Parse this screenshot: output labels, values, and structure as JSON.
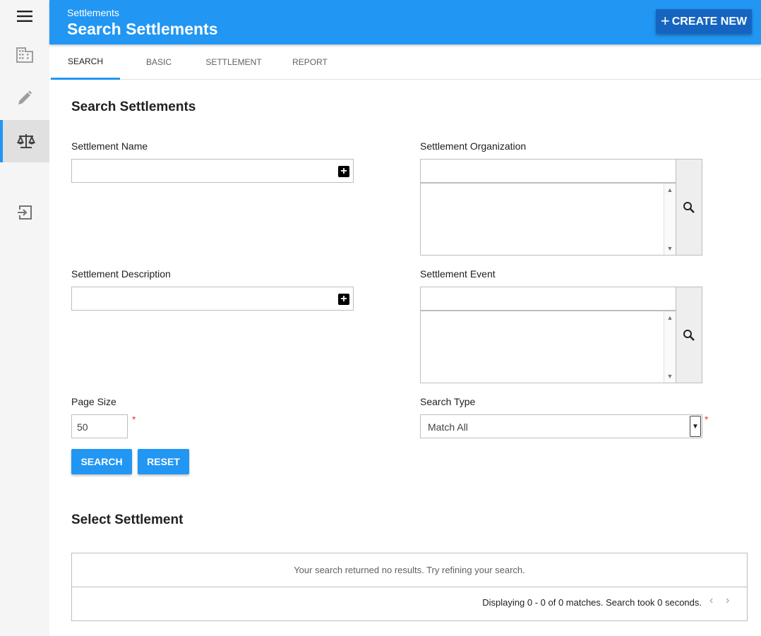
{
  "rail": {
    "items": [
      {
        "icon": "menu-icon"
      },
      {
        "icon": "building-icon"
      },
      {
        "icon": "pencil-icon"
      },
      {
        "icon": "scales-icon",
        "active": true
      },
      {
        "icon": "sign-in-icon"
      }
    ]
  },
  "header": {
    "breadcrumb": "Settlements",
    "title": "Search Settlements",
    "create_label": "CREATE NEW",
    "create_icon": "plus-icon",
    "color": "#2196f3"
  },
  "tabs": [
    {
      "label": "SEARCH",
      "active": true
    },
    {
      "label": "BASIC"
    },
    {
      "label": "SETTLEMENT"
    },
    {
      "label": "REPORT"
    }
  ],
  "form": {
    "heading": "Search Settlements",
    "settlement_name": {
      "label": "Settlement Name",
      "value": ""
    },
    "settlement_description": {
      "label": "Settlement Description",
      "value": ""
    },
    "settlement_organization": {
      "label": "Settlement Organization",
      "value": ""
    },
    "settlement_event": {
      "label": "Settlement Event",
      "value": ""
    },
    "page_size": {
      "label": "Page Size",
      "value": "50",
      "required_mark": "*"
    },
    "search_type": {
      "label": "Search Type",
      "value": "Match All",
      "required_mark": "*"
    },
    "search_button": "SEARCH",
    "reset_button": "RESET"
  },
  "results": {
    "heading": "Select Settlement",
    "empty_message": "Your search returned no results. Try refining your search.",
    "status": "Displaying 0 - 0 of 0 matches. Search took 0 seconds.",
    "prev_icon": "chevron-left-icon",
    "next_icon": "chevron-right-icon"
  }
}
